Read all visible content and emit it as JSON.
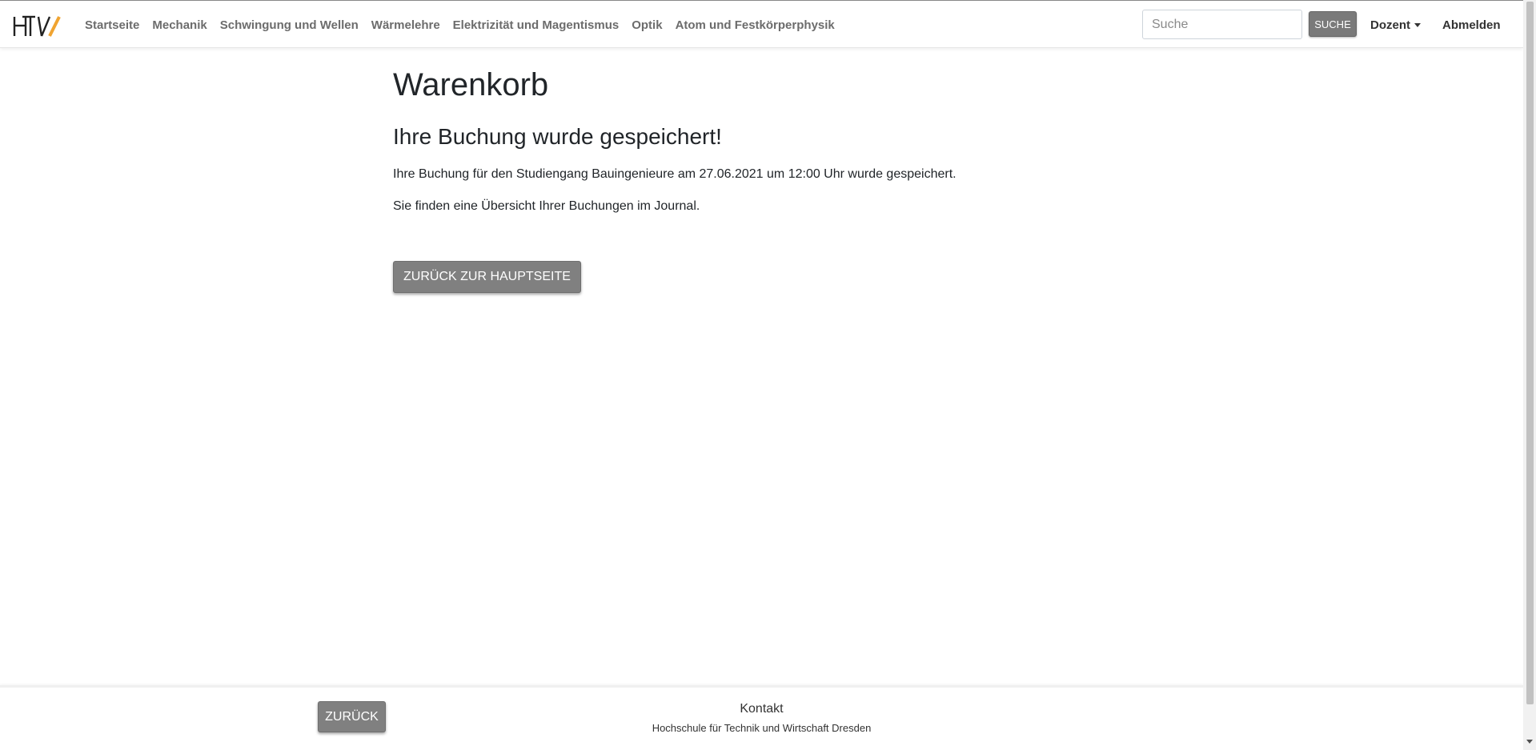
{
  "header": {
    "nav": [
      {
        "label": "Startseite"
      },
      {
        "label": "Mechanik"
      },
      {
        "label": "Schwingung und Wellen"
      },
      {
        "label": "Wärmelehre"
      },
      {
        "label": "Elektrizität und Magentismus"
      },
      {
        "label": "Optik"
      },
      {
        "label": "Atom und Festkörperphysik"
      }
    ],
    "search": {
      "placeholder": "Suche",
      "button_label": "SUCHE"
    },
    "user_menu_label": "Dozent",
    "logout_label": "Abmelden"
  },
  "main": {
    "title": "Warenkorb",
    "subtitle": "Ihre Buchung wurde gespeichert!",
    "message_1": "Ihre Buchung für den Studiengang Bauingenieure am 27.06.2021 um 12:00 Uhr wurde gespeichert.",
    "message_2": "Sie finden eine Übersicht Ihrer Buchungen im Journal.",
    "home_button_label": "Zurück zur Hauptseite"
  },
  "footer": {
    "back_button_label": "Zurück",
    "contact_title": "Kontakt",
    "institution": "Hochschule für Technik und Wirtschaft Dresden"
  },
  "colors": {
    "logo_accent": "#f0a431",
    "button_gray": "#808080"
  }
}
